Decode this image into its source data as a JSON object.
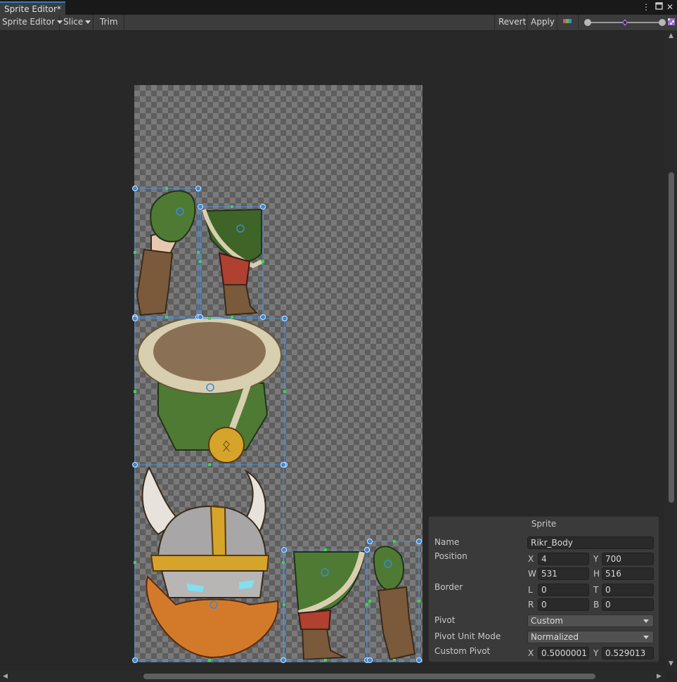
{
  "window": {
    "tab_title": "Sprite Editor*",
    "buttons": [
      "more-options",
      "maximize",
      "close"
    ]
  },
  "toolbar": {
    "mode_label": "Sprite Editor",
    "slice_label": "Slice",
    "trim_label": "Trim",
    "revert_label": "Revert",
    "apply_label": "Apply"
  },
  "sprite_panel": {
    "title": "Sprite",
    "name_label": "Name",
    "name_value": "Rikr_Body",
    "position_label": "Position",
    "x_label": "X",
    "x_value": "4",
    "y_label": "Y",
    "y_value": "700",
    "w_label": "W",
    "w_value": "531",
    "h_label": "H",
    "h_value": "516",
    "border_label": "Border",
    "l_label": "L",
    "l_value": "0",
    "t_label": "T",
    "t_value": "0",
    "r_label": "R",
    "r_value": "0",
    "b_label": "B",
    "b_value": "0",
    "pivot_label": "Pivot",
    "pivot_value": "Custom",
    "pivot_unit_label": "Pivot Unit Mode",
    "pivot_unit_value": "Normalized",
    "custom_pivot_label": "Custom Pivot",
    "cp_x_label": "X",
    "cp_x_value": "0.5000001",
    "cp_y_label": "Y",
    "cp_y_value": "0.529013"
  },
  "colors": {
    "accent": "#3a79bb",
    "sprite_rect": "#4d8fd6",
    "handle_green": "#39d94a",
    "background": "#282828"
  }
}
